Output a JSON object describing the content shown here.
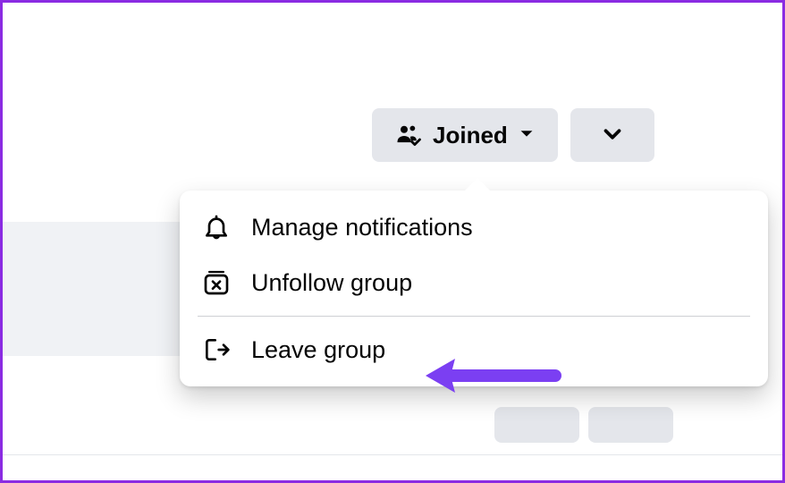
{
  "joinedButton": {
    "label": "Joined"
  },
  "menu": {
    "manageNotifications": "Manage notifications",
    "unfollowGroup": "Unfollow group",
    "leaveGroup": "Leave group"
  },
  "annotation": {
    "arrowColor": "#7b3ff2"
  }
}
